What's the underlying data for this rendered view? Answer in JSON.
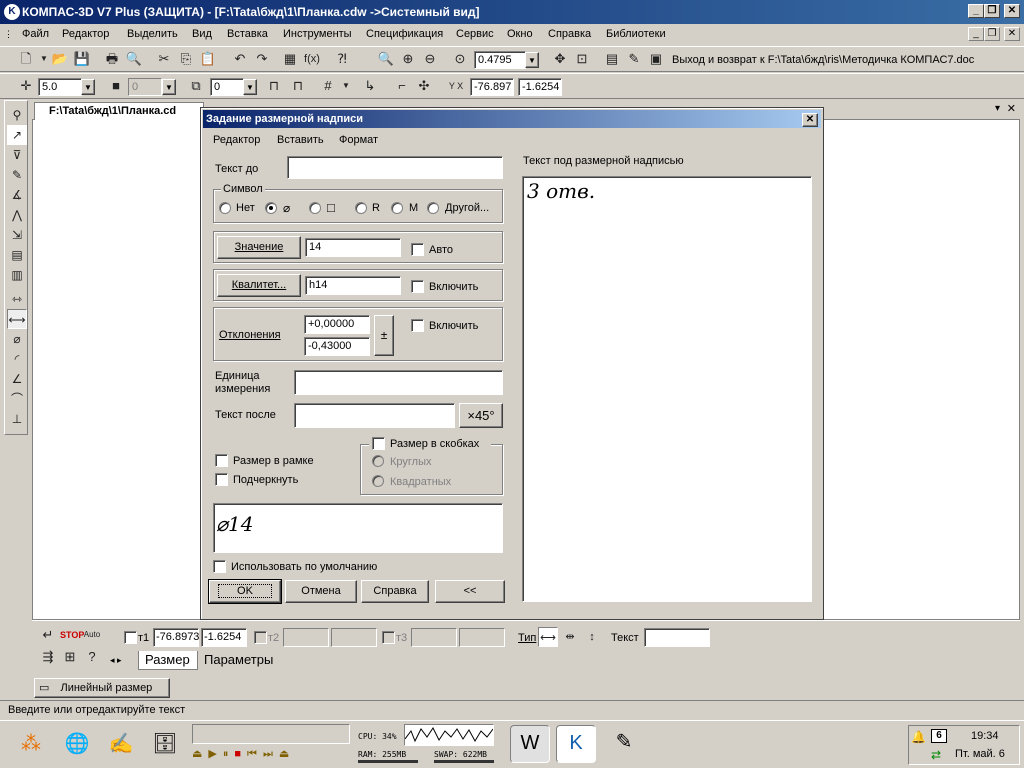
{
  "window": {
    "title": "КОМПАС-3D V7 Plus (ЗАЩИТА) - [F:\\Tata\\бжд\\1\\Планка.cdw ->Системный вид]"
  },
  "menu": [
    "Файл",
    "Редактор",
    "Выделить",
    "Вид",
    "Вставка",
    "Инструменты",
    "Спецификация",
    "Сервис",
    "Окно",
    "Справка",
    "Библиотеки"
  ],
  "toolbar1": {
    "zoom_value": "0.4795",
    "nav_text": "Выход и возврат к F:\\Tata\\бжд\\ris\\Методичка КОМПАС7.doc"
  },
  "toolbar2": {
    "step_value": "5.0",
    "layer_value": "0",
    "style_value": "0",
    "coord_x": "-76.897",
    "coord_y": "-1.6254"
  },
  "document": {
    "tab_label": "F:\\Tata\\бжд\\1\\Планка.cd"
  },
  "dialog": {
    "title": "Задание размерной надписи",
    "menu": [
      "Редактор",
      "Вставить",
      "Формат"
    ],
    "text_before_label": "Текст до",
    "text_before_value": "",
    "symbol_group": "Символ",
    "symbol_options": [
      "Нет",
      "⌀",
      "□",
      "R",
      "M",
      "Другой..."
    ],
    "symbol_selected_index": 1,
    "value_button": "Значение",
    "value_field": "14",
    "auto_label": "Авто",
    "qualitet_button": "Квалитет...",
    "qualitet_field": "h14",
    "include_label_1": "Включить",
    "deviations_label": "Отклонения",
    "dev_upper": "+0,00000",
    "dev_lower": "-0,43000",
    "plusminus": "±",
    "include_label_2": "Включить",
    "unit_label_1": "Единица",
    "unit_label_2": "измерения",
    "unit_value": "",
    "text_after_label": "Текст после",
    "text_after_value": "",
    "x45_button": "×45°",
    "framed_label": "Размер в рамке",
    "underline_label": "Подчеркнуть",
    "brackets_label": "Размер в скобках",
    "brackets_round": "Круглых",
    "brackets_square": "Квадратных",
    "preview_text": "⌀14",
    "use_default_label": "Использовать по умолчанию",
    "ok_button": "OK",
    "cancel_button": "Отмена",
    "help_button": "Справка",
    "collapse_button": "<<",
    "under_text_label": "Текст под размерной надписью",
    "under_text_value": "3 отв."
  },
  "properties": {
    "t1_label": "т1",
    "t1_x": "-76.8973",
    "t1_y": "-1.6254",
    "t2_label": "т2",
    "t3_label": "т3",
    "type_label": "Тип",
    "text_label": "Текст",
    "text_value": "",
    "tab_size": "Размер",
    "tab_params": "Параметры",
    "command_label": "Линейный размер"
  },
  "status": {
    "message": "Введите или отредактируйте текст"
  },
  "taskbar": {
    "cpu": "CPU: 34%",
    "ram": "RAM: 255MB",
    "swap": "SWAP: 622MB",
    "lang_badge": "6",
    "time": "19:34",
    "date": "Пт. май. 6"
  }
}
